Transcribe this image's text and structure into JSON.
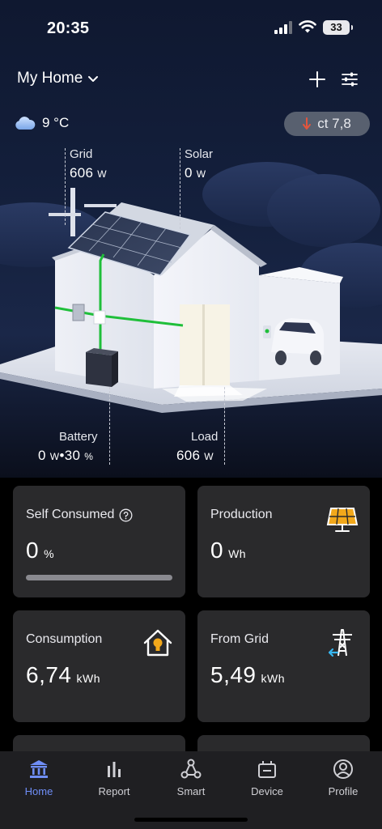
{
  "status_bar": {
    "time": "20:35",
    "battery": "33"
  },
  "header": {
    "home_name": "My Home"
  },
  "weather": {
    "temperature": "9 °C",
    "icon": "cloud-icon"
  },
  "price": {
    "value": "ct 7,8",
    "trend": "down"
  },
  "energy_flow": {
    "grid": {
      "label": "Grid",
      "value": "606",
      "unit": "W"
    },
    "solar": {
      "label": "Solar",
      "value": "0",
      "unit": "W"
    },
    "battery": {
      "label": "Battery",
      "power": "0",
      "power_unit": "W",
      "separator": "•",
      "soc": "30",
      "soc_unit": "%"
    },
    "load": {
      "label": "Load",
      "value": "606",
      "unit": "W"
    }
  },
  "cards": [
    {
      "title": "Self Consumed",
      "value": "0",
      "unit": "%",
      "progress": 0,
      "icon": "help-icon"
    },
    {
      "title": "Production",
      "value": "0",
      "unit": "Wh",
      "icon": "solar-panel-icon"
    },
    {
      "title": "Consumption",
      "value": "6,74",
      "unit": "kWh",
      "icon": "house-bulb-icon"
    },
    {
      "title": "From Grid",
      "value": "5,49",
      "unit": "kWh",
      "icon": "power-tower-icon"
    }
  ],
  "tabs": [
    {
      "label": "Home",
      "icon": "home-icon",
      "active": true
    },
    {
      "label": "Report",
      "icon": "bar-chart-icon",
      "active": false
    },
    {
      "label": "Smart",
      "icon": "nodes-icon",
      "active": false
    },
    {
      "label": "Device",
      "icon": "device-icon",
      "active": false
    },
    {
      "label": "Profile",
      "icon": "profile-icon",
      "active": false
    }
  ],
  "colors": {
    "accent": "#6f8ef7",
    "card_bg": "#2a2a2c",
    "flow_green": "#1fbf3a",
    "price_arrow": "#e2553d"
  }
}
